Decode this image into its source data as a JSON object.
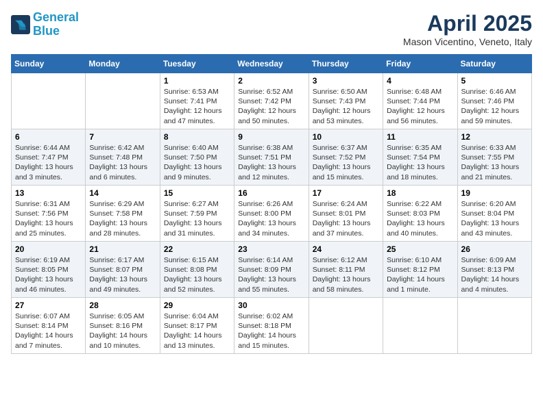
{
  "logo": {
    "line1": "General",
    "line2": "Blue"
  },
  "title": "April 2025",
  "subtitle": "Mason Vicentino, Veneto, Italy",
  "days_of_week": [
    "Sunday",
    "Monday",
    "Tuesday",
    "Wednesday",
    "Thursday",
    "Friday",
    "Saturday"
  ],
  "weeks": [
    [
      {
        "day": "",
        "info": ""
      },
      {
        "day": "",
        "info": ""
      },
      {
        "day": "1",
        "info": "Sunrise: 6:53 AM\nSunset: 7:41 PM\nDaylight: 12 hours and 47 minutes."
      },
      {
        "day": "2",
        "info": "Sunrise: 6:52 AM\nSunset: 7:42 PM\nDaylight: 12 hours and 50 minutes."
      },
      {
        "day": "3",
        "info": "Sunrise: 6:50 AM\nSunset: 7:43 PM\nDaylight: 12 hours and 53 minutes."
      },
      {
        "day": "4",
        "info": "Sunrise: 6:48 AM\nSunset: 7:44 PM\nDaylight: 12 hours and 56 minutes."
      },
      {
        "day": "5",
        "info": "Sunrise: 6:46 AM\nSunset: 7:46 PM\nDaylight: 12 hours and 59 minutes."
      }
    ],
    [
      {
        "day": "6",
        "info": "Sunrise: 6:44 AM\nSunset: 7:47 PM\nDaylight: 13 hours and 3 minutes."
      },
      {
        "day": "7",
        "info": "Sunrise: 6:42 AM\nSunset: 7:48 PM\nDaylight: 13 hours and 6 minutes."
      },
      {
        "day": "8",
        "info": "Sunrise: 6:40 AM\nSunset: 7:50 PM\nDaylight: 13 hours and 9 minutes."
      },
      {
        "day": "9",
        "info": "Sunrise: 6:38 AM\nSunset: 7:51 PM\nDaylight: 13 hours and 12 minutes."
      },
      {
        "day": "10",
        "info": "Sunrise: 6:37 AM\nSunset: 7:52 PM\nDaylight: 13 hours and 15 minutes."
      },
      {
        "day": "11",
        "info": "Sunrise: 6:35 AM\nSunset: 7:54 PM\nDaylight: 13 hours and 18 minutes."
      },
      {
        "day": "12",
        "info": "Sunrise: 6:33 AM\nSunset: 7:55 PM\nDaylight: 13 hours and 21 minutes."
      }
    ],
    [
      {
        "day": "13",
        "info": "Sunrise: 6:31 AM\nSunset: 7:56 PM\nDaylight: 13 hours and 25 minutes."
      },
      {
        "day": "14",
        "info": "Sunrise: 6:29 AM\nSunset: 7:58 PM\nDaylight: 13 hours and 28 minutes."
      },
      {
        "day": "15",
        "info": "Sunrise: 6:27 AM\nSunset: 7:59 PM\nDaylight: 13 hours and 31 minutes."
      },
      {
        "day": "16",
        "info": "Sunrise: 6:26 AM\nSunset: 8:00 PM\nDaylight: 13 hours and 34 minutes."
      },
      {
        "day": "17",
        "info": "Sunrise: 6:24 AM\nSunset: 8:01 PM\nDaylight: 13 hours and 37 minutes."
      },
      {
        "day": "18",
        "info": "Sunrise: 6:22 AM\nSunset: 8:03 PM\nDaylight: 13 hours and 40 minutes."
      },
      {
        "day": "19",
        "info": "Sunrise: 6:20 AM\nSunset: 8:04 PM\nDaylight: 13 hours and 43 minutes."
      }
    ],
    [
      {
        "day": "20",
        "info": "Sunrise: 6:19 AM\nSunset: 8:05 PM\nDaylight: 13 hours and 46 minutes."
      },
      {
        "day": "21",
        "info": "Sunrise: 6:17 AM\nSunset: 8:07 PM\nDaylight: 13 hours and 49 minutes."
      },
      {
        "day": "22",
        "info": "Sunrise: 6:15 AM\nSunset: 8:08 PM\nDaylight: 13 hours and 52 minutes."
      },
      {
        "day": "23",
        "info": "Sunrise: 6:14 AM\nSunset: 8:09 PM\nDaylight: 13 hours and 55 minutes."
      },
      {
        "day": "24",
        "info": "Sunrise: 6:12 AM\nSunset: 8:11 PM\nDaylight: 13 hours and 58 minutes."
      },
      {
        "day": "25",
        "info": "Sunrise: 6:10 AM\nSunset: 8:12 PM\nDaylight: 14 hours and 1 minute."
      },
      {
        "day": "26",
        "info": "Sunrise: 6:09 AM\nSunset: 8:13 PM\nDaylight: 14 hours and 4 minutes."
      }
    ],
    [
      {
        "day": "27",
        "info": "Sunrise: 6:07 AM\nSunset: 8:14 PM\nDaylight: 14 hours and 7 minutes."
      },
      {
        "day": "28",
        "info": "Sunrise: 6:05 AM\nSunset: 8:16 PM\nDaylight: 14 hours and 10 minutes."
      },
      {
        "day": "29",
        "info": "Sunrise: 6:04 AM\nSunset: 8:17 PM\nDaylight: 14 hours and 13 minutes."
      },
      {
        "day": "30",
        "info": "Sunrise: 6:02 AM\nSunset: 8:18 PM\nDaylight: 14 hours and 15 minutes."
      },
      {
        "day": "",
        "info": ""
      },
      {
        "day": "",
        "info": ""
      },
      {
        "day": "",
        "info": ""
      }
    ]
  ]
}
